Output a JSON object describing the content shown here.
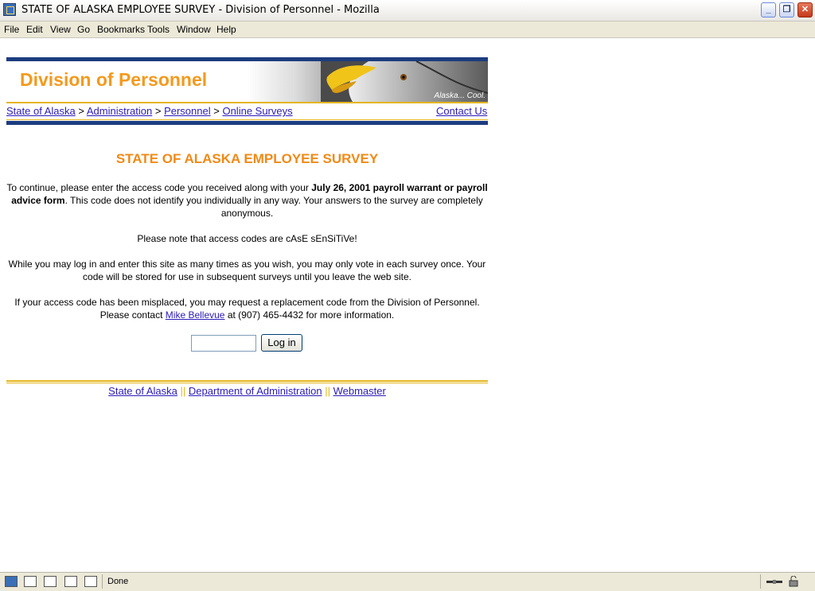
{
  "window": {
    "title": "STATE OF ALASKA EMPLOYEE SURVEY - Division of Personnel - Mozilla",
    "minimize": "_",
    "maximize": "❐",
    "close": "✕"
  },
  "menu": {
    "file": "File",
    "edit": "Edit",
    "view": "View",
    "go": "Go",
    "bookmarks": "Bookmarks",
    "tools": "Tools",
    "window": "Window",
    "help": "Help"
  },
  "banner": {
    "title": "Division of Personnel",
    "tagline": "Alaska... Cool."
  },
  "breadcrumb": {
    "items": [
      "State of Alaska",
      "Administration",
      "Personnel",
      "Online Surveys"
    ],
    "separator": ">",
    "contact": "Contact Us"
  },
  "survey": {
    "heading": "STATE OF ALASKA EMPLOYEE SURVEY",
    "p1_a": "To continue, please enter the access code you received along with your ",
    "p1_bold": "July 26, 2001 payroll warrant or payroll advice form",
    "p1_b": ". This code does not identify you individually in any way. Your answers to the survey are completely anonymous.",
    "p2": "Please note that access codes are cAsE sEnSiTiVe!",
    "p3": "While you may log in and enter this site as many times as you wish, you may only vote in each survey once. Your code will be stored for use in subsequent surveys until you leave the web site.",
    "p4_a": "If your access code has been misplaced, you may request a replacement code from the Division of Personnel. Please contact ",
    "p4_link": "Mike Bellevue",
    "p4_b": " at (907) 465-4432 for more information.",
    "access_code_value": "",
    "login_label": "Log in"
  },
  "footer": {
    "links": [
      "State of Alaska",
      "Department of Administration",
      "Webmaster"
    ],
    "separator": "||"
  },
  "status": {
    "text": "Done"
  },
  "colors": {
    "banner_blue": "#1c3c7e",
    "accent_orange": "#f39a1e",
    "gold_rule": "#e5b51d",
    "link": "#2b1bb8"
  }
}
